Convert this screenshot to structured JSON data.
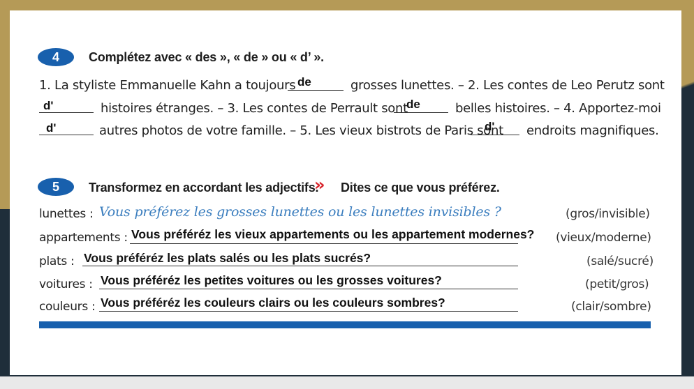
{
  "exercise4": {
    "number": "4",
    "title": "Complétez avec « des », « de » ou « d’ ».",
    "lines": [
      {
        "pre": "1. La styliste Emmanuelle Kahn a toujours",
        "answer1": "de",
        "post": "grosses lunettes. – 2. Les contes de Leo Perutz sont"
      },
      {
        "answer1": "d'",
        "mid": "histoires étranges. – 3. Les contes de Perrault sont",
        "answer2": "de",
        "post": "belles histoires. – 4. Apportez-moi"
      },
      {
        "answer1": "d'",
        "mid": "autres photos de votre famille. – 5. Les vieux bistrots de Paris sont",
        "answer2": "d'",
        "post": "endroits magnifiques."
      }
    ]
  },
  "exercise5": {
    "number": "5",
    "title": "Transformez en accordant les adjectifs.",
    "chevron": "»",
    "subtitle": "Dites ce que vous préférez.",
    "rows": [
      {
        "label": "lunettes :",
        "text": "Vous préférez les grosses lunettes ou les lunettes invisibles ?",
        "hint": "(gros/invisible)"
      },
      {
        "label": "appartements :",
        "text": "Vous préféréz les vieux appartements ou les appartement modernes?",
        "hint": "(vieux/moderne)"
      },
      {
        "label": "plats :",
        "text": "Vous préféréz les plats salés ou les plats sucrés?",
        "hint": "(salé/sucré)"
      },
      {
        "label": "voitures :",
        "text": "Vous préféréz les petites voitures ou les grosses voitures?",
        "hint": "(petit/gros)"
      },
      {
        "label": "couleurs :",
        "text": "Vous préféréz les couleurs clairs ou les couleurs sombres?",
        "hint": "(clair/sombre)"
      }
    ]
  },
  "colors": {
    "accent_blue": "#1860ad",
    "chevron_red": "#d8232a",
    "example_blue": "#3a7dbe",
    "frame_gold": "#b59a57",
    "frame_dark": "#1f2e3a"
  }
}
